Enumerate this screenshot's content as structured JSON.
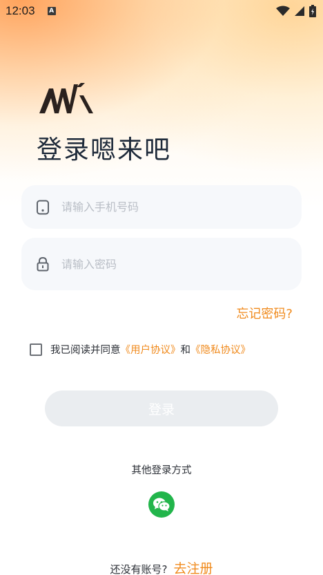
{
  "status_bar": {
    "time": "12:03",
    "notification_badge": "A"
  },
  "title": "登录嗯来吧",
  "phone_field": {
    "placeholder": "请输入手机号码",
    "value": ""
  },
  "password_field": {
    "placeholder": "请输入密码",
    "value": ""
  },
  "forgot_password": "忘记密码?",
  "agreement": {
    "prefix": "我已阅读并同意",
    "user_agreement": "《用户协议》",
    "and": "和",
    "privacy_policy": "《隐私协议》",
    "checked": false
  },
  "login_button": "登录",
  "other_login_label": "其他登录方式",
  "register": {
    "question": "还没有账号?",
    "link": "去注册"
  },
  "colors": {
    "accent": "#f08a1c",
    "wechat": "#22b54b",
    "disabled_button": "#eaedf0",
    "field_bg": "#f6f8fb"
  },
  "icons": [
    "phone-icon",
    "lock-icon",
    "wechat-icon",
    "wifi-icon",
    "signal-icon",
    "battery-icon"
  ]
}
